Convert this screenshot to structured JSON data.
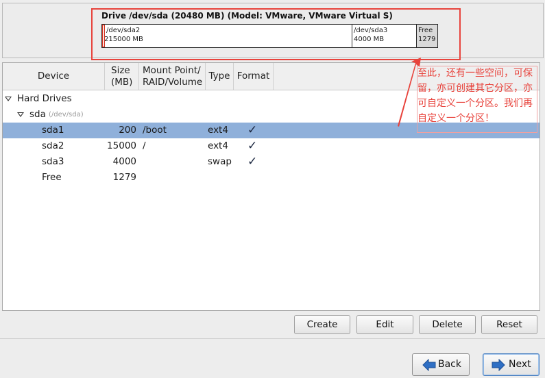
{
  "drive": {
    "title": "Drive /dev/sda (20480 MB) (Model: VMware, VMware Virtual S)",
    "segments": {
      "sda2": {
        "name": "/dev/sda2",
        "size": "15000 MB",
        "sda1_mark": "2"
      },
      "sda3": {
        "name": "/dev/sda3",
        "size": "4000 MB"
      },
      "free": {
        "name": "Free",
        "size": "1279"
      }
    }
  },
  "table": {
    "headers": {
      "device": "Device",
      "size_line1": "Size",
      "size_line2": "(MB)",
      "mount_line1": "Mount Point/",
      "mount_line2": "RAID/Volume",
      "type": "Type",
      "format": "Format"
    },
    "hard_drives_label": "Hard Drives",
    "disk": {
      "name": "sda",
      "path": "(/dev/sda)"
    },
    "rows": [
      {
        "device": "sda1",
        "size": "200",
        "mount": "/boot",
        "type": "ext4",
        "format": "✓"
      },
      {
        "device": "sda2",
        "size": "15000",
        "mount": "/",
        "type": "ext4",
        "format": "✓"
      },
      {
        "device": "sda3",
        "size": "4000",
        "mount": "",
        "type": "swap",
        "format": "✓"
      },
      {
        "device": "Free",
        "size": "1279",
        "mount": "",
        "type": "",
        "format": ""
      }
    ]
  },
  "buttons": {
    "create": "Create",
    "edit": "Edit",
    "delete": "Delete",
    "reset": "Reset",
    "back": "Back",
    "next": "Next"
  },
  "annotation": {
    "text": "至此，还有一些空间，可保留，亦可创建其它分区，亦可自定义一个分区。我们再自定义一个分区！",
    "color": "#e8433c"
  },
  "colors": {
    "selected_row": "#8fb0da",
    "annotation": "#e8433c"
  }
}
